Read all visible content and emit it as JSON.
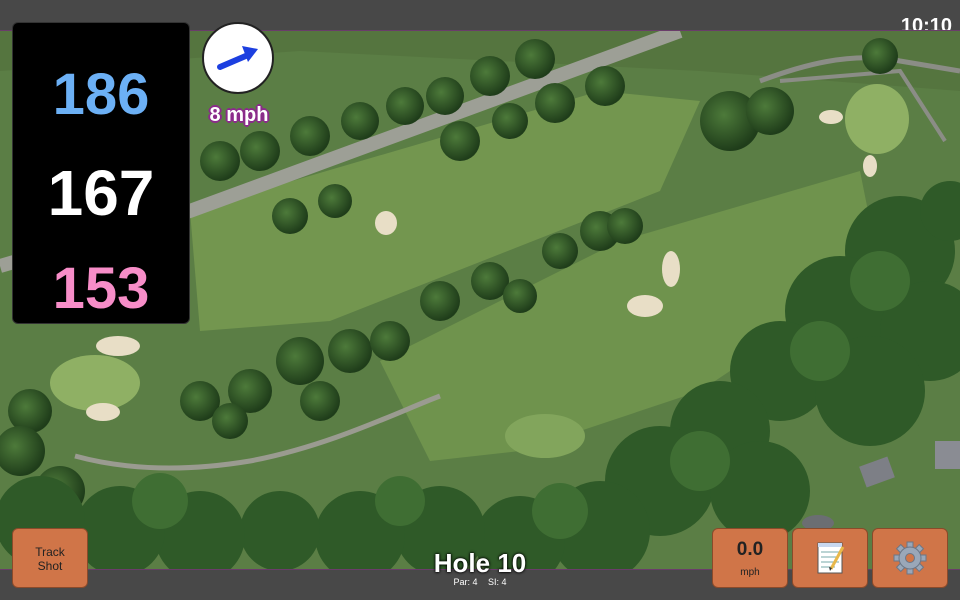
{
  "status": {
    "time": "10:10"
  },
  "yardage": {
    "back": "186",
    "middle": "167",
    "front": "153"
  },
  "wind": {
    "speed_label": "8 mph",
    "icon": "wind-direction-arrow-icon"
  },
  "buttons": {
    "track_shot": "Track Shot",
    "speed_value": "0.0",
    "speed_unit": "mph",
    "notes_icon": "notepad-icon",
    "settings_icon": "gear-icon"
  },
  "hole": {
    "title": "Hole 10",
    "par": "Par: 4",
    "si": "SI: 4"
  },
  "colors": {
    "back": "#6cb0f5",
    "middle": "#ffffff",
    "front": "#f78dc8",
    "button": "#d07548",
    "wind_outline": "#8b2a8b"
  }
}
